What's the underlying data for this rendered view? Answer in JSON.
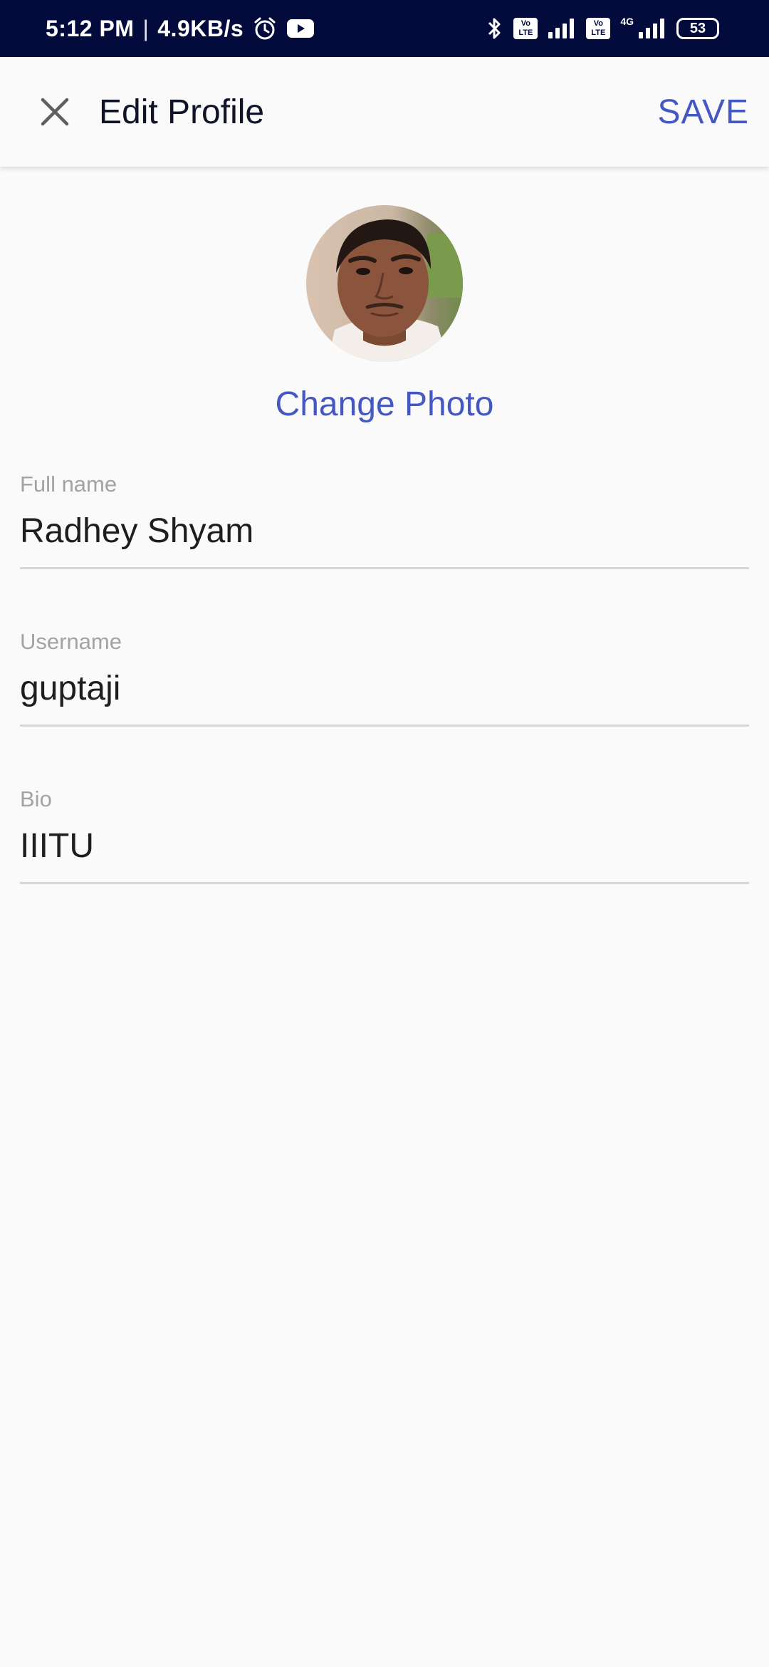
{
  "status_bar": {
    "time": "5:12 PM",
    "separator": "|",
    "speed": "4.9KB/s",
    "volte1": "Vo LTE",
    "volte2": "Vo LTE",
    "network_type": "4G",
    "battery_level": "53",
    "icons": [
      "alarm-icon",
      "youtube-icon",
      "bluetooth-icon",
      "signal-icon",
      "battery-icon"
    ],
    "background_color": "#020b3b"
  },
  "app_bar": {
    "title": "Edit Profile",
    "save_label": "SAVE",
    "close_icon": "close-icon",
    "accent_color": "#4558c2"
  },
  "profile": {
    "change_photo_label": "Change Photo"
  },
  "fields": [
    {
      "label": "Full name",
      "value": "Radhey Shyam"
    },
    {
      "label": "Username",
      "value": "guptaji"
    },
    {
      "label": "Bio",
      "value": "IIITU"
    }
  ]
}
